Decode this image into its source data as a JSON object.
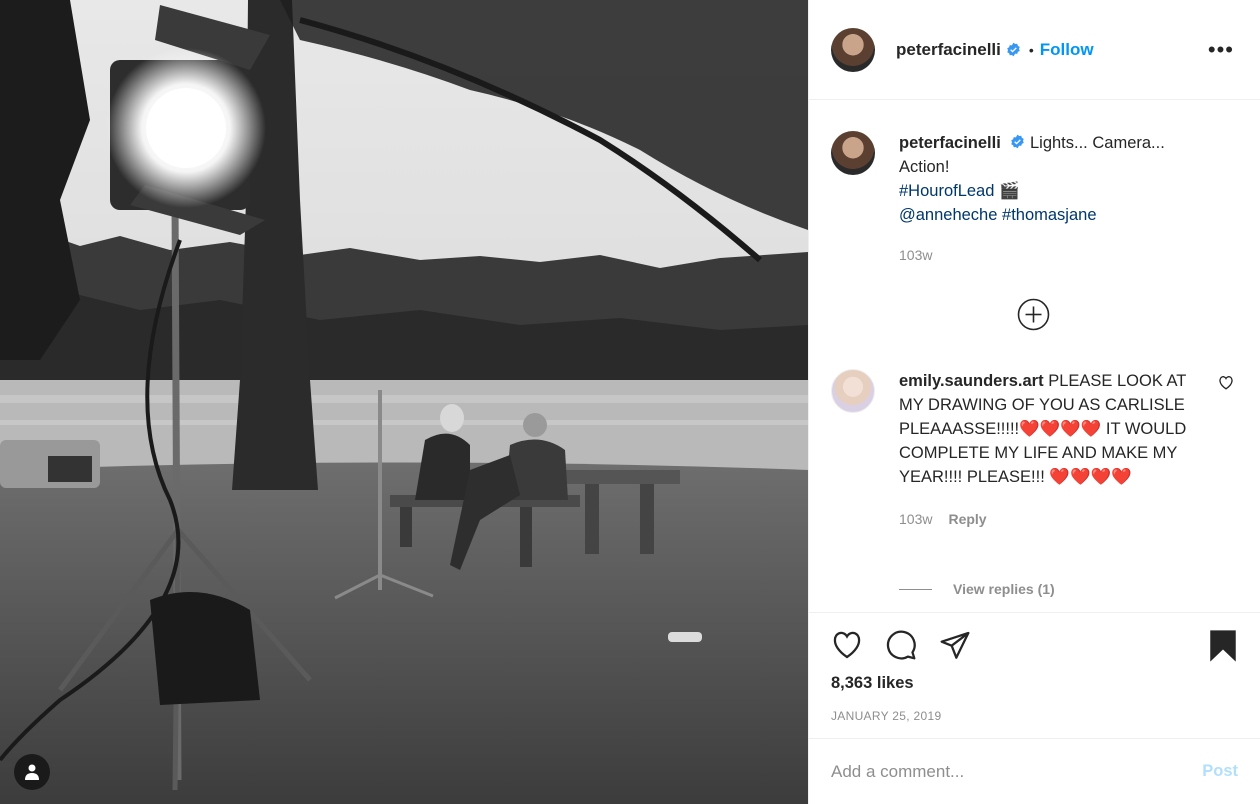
{
  "post": {
    "username": "peterfacinelli",
    "follow_label": "Follow",
    "separator": "•",
    "more_icon": "more-options-icon",
    "photo_alt": "Black and white photo of a film set by a lake"
  },
  "caption": {
    "username": "peterfacinelli",
    "text": "Lights... Camera... Action!",
    "hashtag1": "#HourofLead",
    "emoji": "🎬",
    "mention": "@anneheche",
    "hashtag2": "#thomasjane",
    "time": "103w"
  },
  "comment": {
    "username": "emily.saunders.art",
    "text": "PLEASE LOOK AT MY DRAWING OF YOU AS CARLISLE PLEAAASSE!!!!!❤️❤️❤️❤️ IT WOULD COMPLETE MY LIFE AND MAKE MY YEAR!!!! PLEASE!!! ❤️❤️❤️❤️",
    "time": "103w",
    "reply_label": "Reply",
    "view_replies": "View replies (1)"
  },
  "stats": {
    "likes": "8,363 likes",
    "date": "JANUARY 25, 2019"
  },
  "composer": {
    "placeholder": "Add a comment...",
    "post_label": "Post"
  },
  "colors": {
    "accent": "#0095f6",
    "link": "#00376b",
    "muted": "#8e8e8e"
  }
}
